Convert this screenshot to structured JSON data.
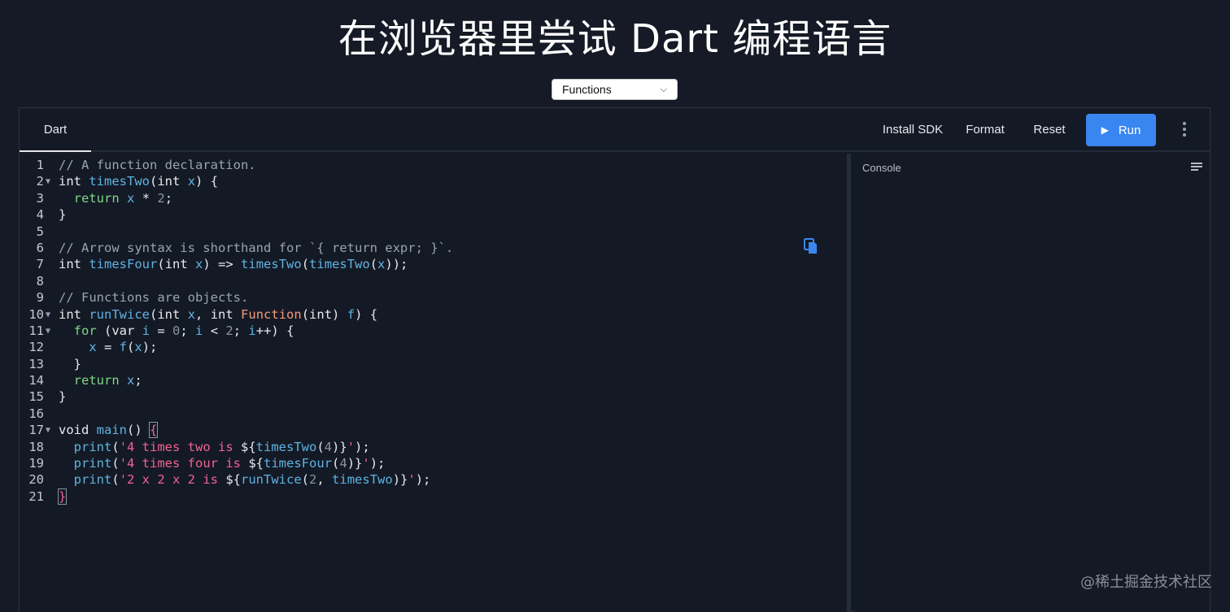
{
  "page": {
    "title": "在浏览器里尝试 Dart 编程语言",
    "watermark": "@稀土掘金技术社区"
  },
  "sample_select": {
    "selected": "Functions"
  },
  "toolbar": {
    "tab_label": "Dart",
    "install_sdk_label": "Install SDK",
    "format_label": "Format",
    "reset_label": "Reset",
    "run_label": "Run"
  },
  "console": {
    "label": "Console"
  },
  "icons": {
    "copy": "copy-icon",
    "clear_console": "clear-console-icon",
    "more": "more-vert-icon",
    "run": "play-icon",
    "dropdown": "chevron-down-icon"
  },
  "colors": {
    "background": "#151a26",
    "accent": "#3a86f0",
    "string": "#f06292",
    "identifier": "#5fb3e4",
    "return_kw": "#7fd787"
  },
  "code": {
    "line_numbers": [
      "1",
      "2",
      "3",
      "4",
      "5",
      "6",
      "7",
      "8",
      "9",
      "10",
      "11",
      "12",
      "13",
      "14",
      "15",
      "16",
      "17",
      "18",
      "19",
      "20",
      "21"
    ],
    "lines": [
      "// A function declaration.",
      "int timesTwo(int x) {",
      "  return x * 2;",
      "}",
      "",
      "// Arrow syntax is shorthand for `{ return expr; }`.",
      "int timesFour(int x) => timesTwo(timesTwo(x));",
      "",
      "// Functions are objects.",
      "int runTwice(int x, int Function(int) f) {",
      "  for (var i = 0; i < 2; i++) {",
      "    x = f(x);",
      "  }",
      "  return x;",
      "}",
      "",
      "void main() {",
      "  print('4 times two is ${timesTwo(4)}');",
      "  print('4 times four is ${timesFour(4)}');",
      "  print('2 x 2 x 2 is ${runTwice(2, timesTwo)}');",
      "}"
    ]
  }
}
